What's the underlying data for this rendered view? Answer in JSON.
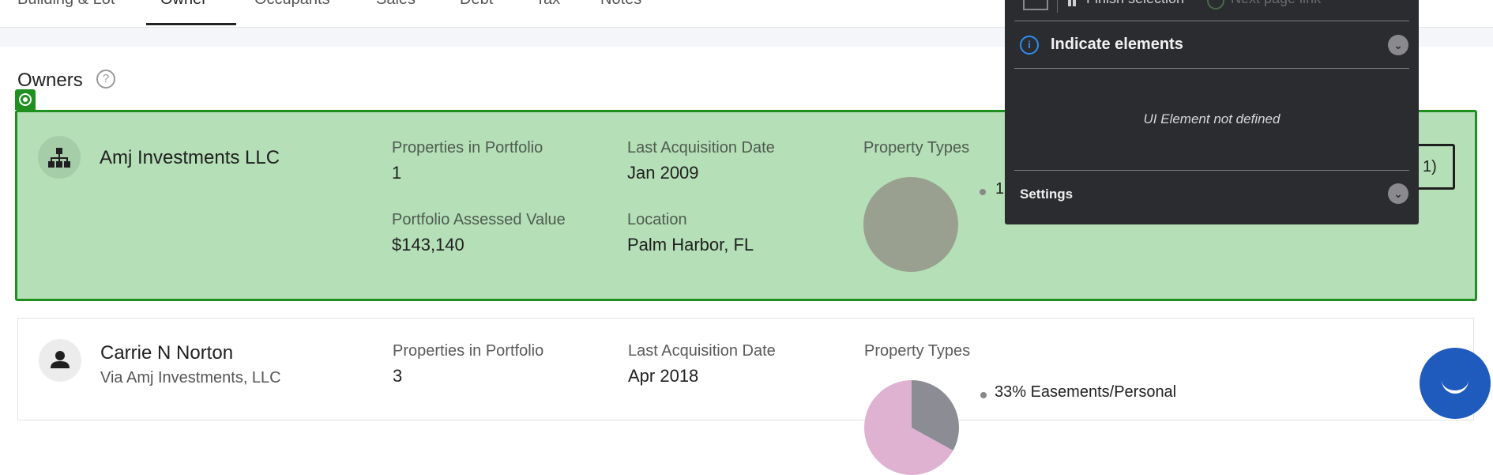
{
  "tabs": [
    {
      "label": "Building & Lot"
    },
    {
      "label": "Owner"
    },
    {
      "label": "Occupants"
    },
    {
      "label": "Sales"
    },
    {
      "label": "Debt"
    },
    {
      "label": "Tax"
    },
    {
      "label": "Notes"
    }
  ],
  "section": {
    "title": "Owners",
    "help_icon": "?"
  },
  "owners": [
    {
      "name": "Amj Investments LLC",
      "properties_label": "Properties in Portfolio",
      "properties_value": "1",
      "acq_label": "Last Acquisition Date",
      "acq_value": "Jan 2009",
      "assessed_label": "Portfolio Assessed Value",
      "assessed_value": "$143,140",
      "location_label": "Location",
      "location_value": "Palm Harbor, FL",
      "types_label": "Property Types",
      "legend_fragment": "1",
      "button_fragment": "1)"
    },
    {
      "name": "Carrie N Norton",
      "via": "Via Amj Investments, LLC",
      "properties_label": "Properties in Portfolio",
      "properties_value": "3",
      "acq_label": "Last Acquisition Date",
      "acq_value": "Apr 2018",
      "types_label": "Property Types",
      "legend_text": "33% Easements/Personal"
    }
  ],
  "panel": {
    "frag1": "Finish selection",
    "frag2": "Next page link",
    "indicate_title": "Indicate elements",
    "message": "UI Element not defined",
    "settings": "Settings"
  },
  "colors": {
    "highlight_bg": "#b4dfb7",
    "highlight_border": "#1f8f1f",
    "panel_bg": "#2b2c30",
    "info_blue": "#2e8ef0",
    "chat_blue": "#1f5bbd"
  }
}
